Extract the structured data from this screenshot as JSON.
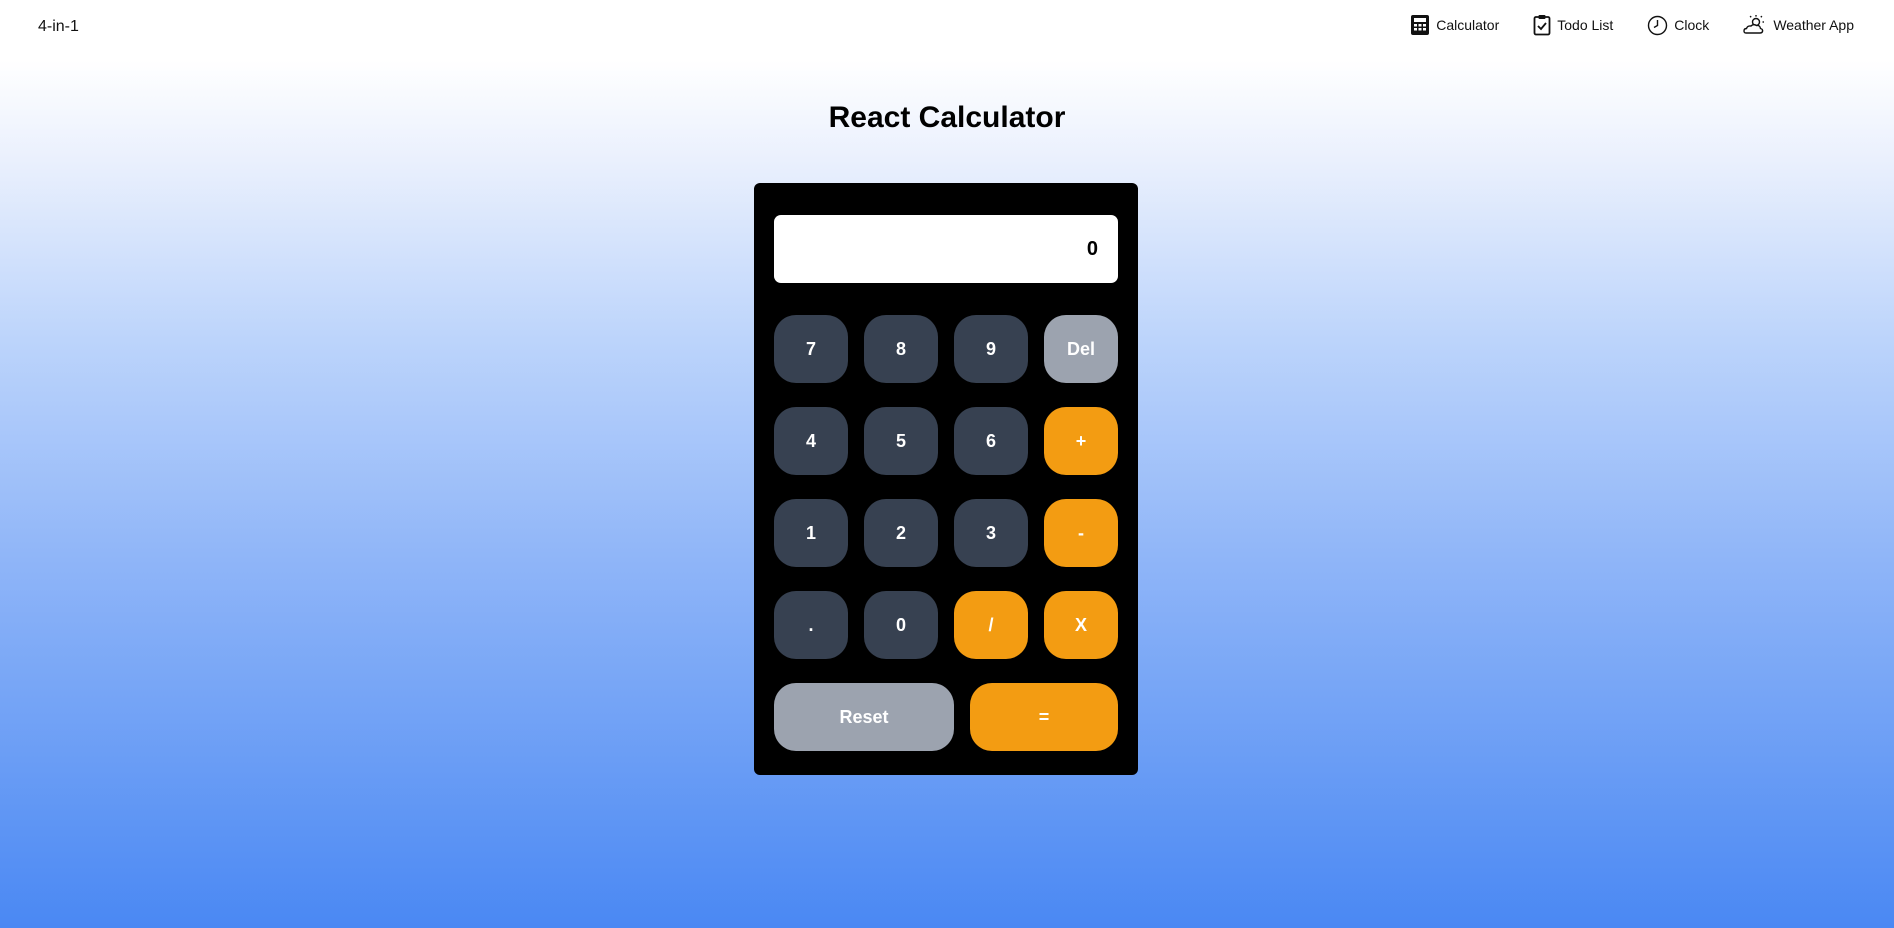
{
  "brand": "4-in-1",
  "nav": [
    {
      "label": "Calculator",
      "icon": "calculator-icon"
    },
    {
      "label": "Todo List",
      "icon": "clipboard-check-icon"
    },
    {
      "label": "Clock",
      "icon": "clock-icon"
    },
    {
      "label": "Weather App",
      "icon": "sun-cloud-icon"
    }
  ],
  "title": "React Calculator",
  "display": "0",
  "keys": {
    "k7": "7",
    "k8": "8",
    "k9": "9",
    "del": "Del",
    "k4": "4",
    "k5": "5",
    "k6": "6",
    "plus": "+",
    "k1": "1",
    "k2": "2",
    "k3": "3",
    "minus": "-",
    "dot": ".",
    "k0": "0",
    "divide": "/",
    "multiply": "X",
    "reset": "Reset",
    "equals": "="
  },
  "colors": {
    "number_key": "#374151",
    "operator_key": "#f39c12",
    "utility_key": "#9ca3af",
    "calculator_body": "#000000",
    "display_bg": "#ffffff"
  }
}
